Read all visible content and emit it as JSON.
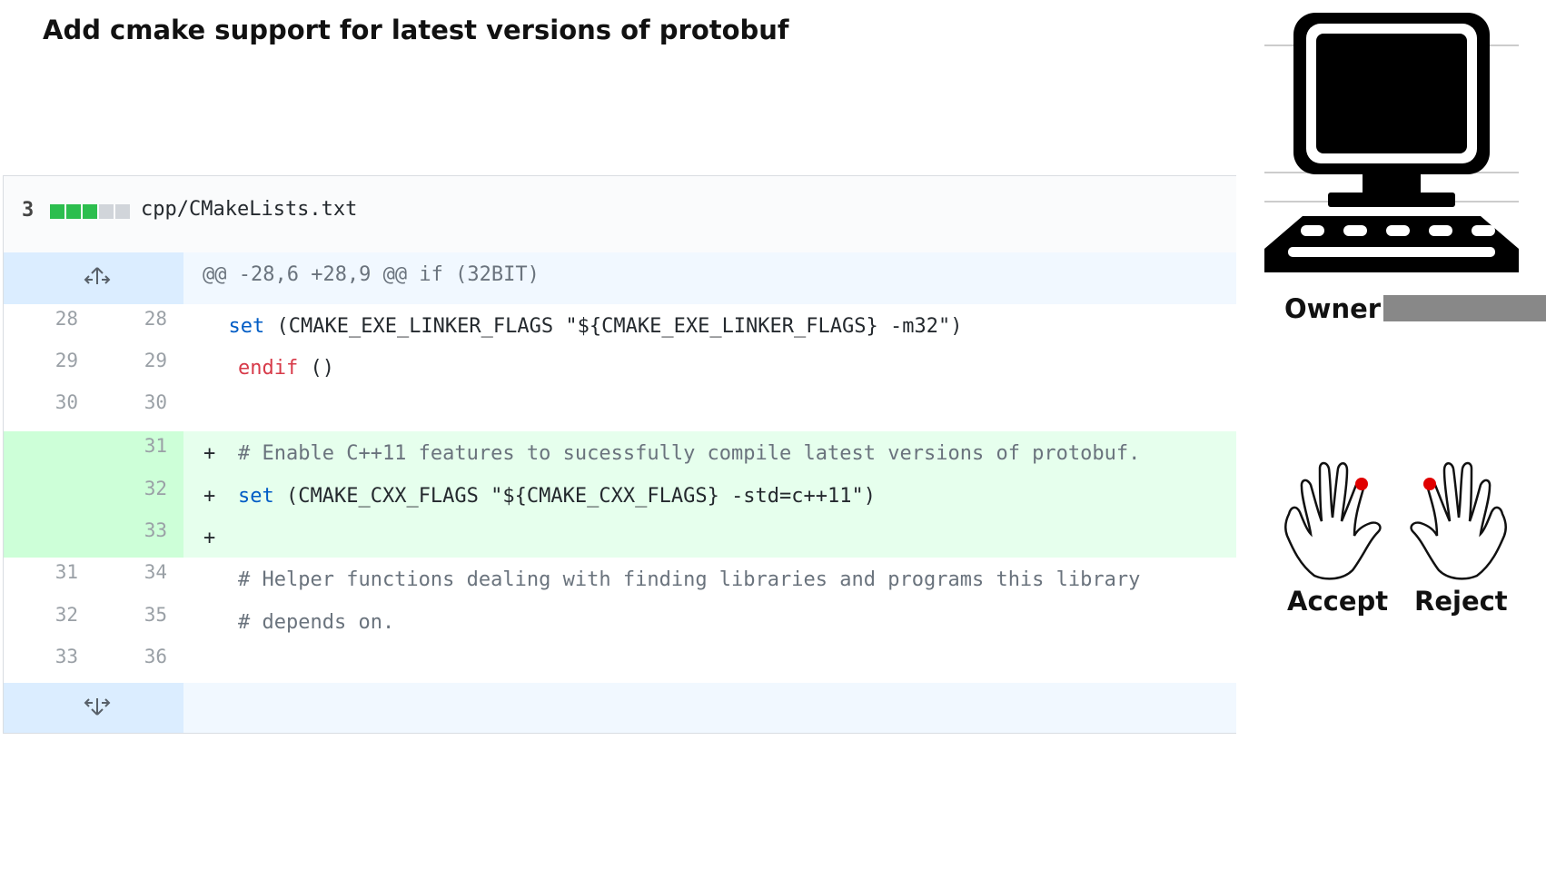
{
  "title": "Add cmake support for latest versions of protobuf",
  "file": {
    "changes_count": "3",
    "diffstat": [
      "added",
      "added",
      "added",
      "neutral",
      "neutral"
    ],
    "path": "cpp/CMakeLists.txt"
  },
  "hunk_header": "@@ -28,6 +28,9 @@ if (32BIT)",
  "lines": [
    {
      "old": "28",
      "new": "28",
      "keyword": "set",
      "rest": " (CMAKE_EXE_LINKER_FLAGS \"${CMAKE_EXE_LINKER_FLAGS} -m32\")"
    },
    {
      "old": "29",
      "new": "29",
      "keyword": "endif",
      "rest": " ()"
    },
    {
      "old": "30",
      "new": "30"
    },
    {
      "new": "31",
      "marker": "+",
      "comment": "# Enable C++11 features to sucessfully compile latest versions of protobuf."
    },
    {
      "new": "32",
      "marker": "+",
      "keyword": "set",
      "rest": " (CMAKE_CXX_FLAGS \"${CMAKE_CXX_FLAGS} -std=c++11\")"
    },
    {
      "new": "33",
      "marker": "+"
    },
    {
      "old": "31",
      "new": "34",
      "comment": "# Helper functions dealing with finding libraries and programs this library"
    },
    {
      "old": "32",
      "new": "35",
      "comment": "# depends on."
    },
    {
      "old": "33",
      "new": "36"
    }
  ],
  "owner_label": "Owner:",
  "actions": {
    "accept": "Accept",
    "reject": "Reject"
  },
  "colors": {
    "added_bg": "#e6ffed",
    "added_gutter": "#cdffd8",
    "hunk_bg": "#f1f8ff",
    "hunk_gutter": "#dbedff",
    "keyword_blue": "#005cc5",
    "keyword_red": "#d73a49",
    "diffstat_added": "#2cbe4e",
    "marker_red": "#e00000"
  }
}
